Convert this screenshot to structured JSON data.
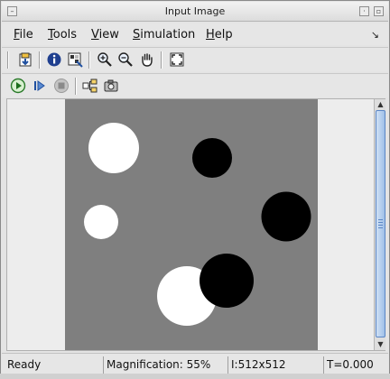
{
  "window": {
    "title": "Input Image"
  },
  "menu": [
    {
      "label": "File"
    },
    {
      "label": "Tools"
    },
    {
      "label": "View"
    },
    {
      "label": "Simulation"
    },
    {
      "label": "Help"
    }
  ],
  "toolbar1": [
    "print-to-figure-icon",
    "info-icon",
    "pixel-region-icon",
    "zoom-in-icon",
    "zoom-out-icon",
    "pan-hand-icon",
    "fit-to-window-icon"
  ],
  "toolbar2": [
    "start-simulation-icon",
    "step-forward-icon",
    "stop-simulation-icon",
    "highlight-block-icon",
    "export-snapshot-icon"
  ],
  "status": {
    "state": "Ready",
    "magnification": "Magnification: 55%",
    "image_size": "I:512x512",
    "time": "T=0.000"
  },
  "colors": {
    "image_background": "#7f7f7f",
    "white_circle": "#ffffff",
    "black_circle": "#000000",
    "scroll_accent": "#5b86c5"
  }
}
